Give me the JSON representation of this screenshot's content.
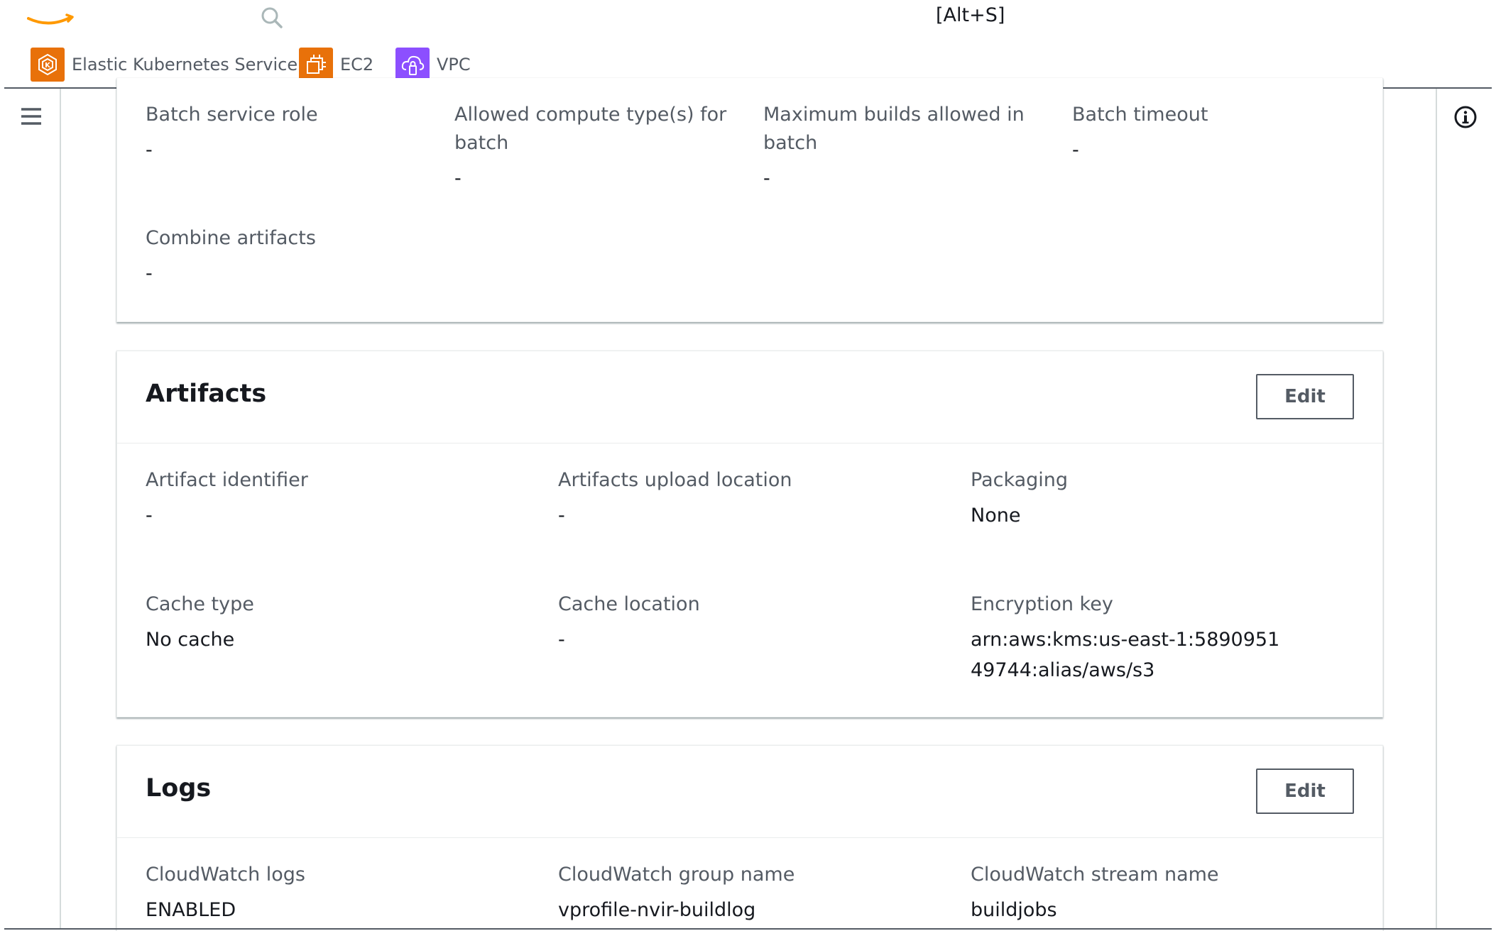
{
  "topbar": {
    "search_shortcut": "[Alt+S]"
  },
  "favorites": [
    {
      "label": "Elastic Kubernetes Service",
      "icon": "eks-icon",
      "color": "#e8710a"
    },
    {
      "label": "EC2",
      "icon": "ec2-icon",
      "color": "#e8710a"
    },
    {
      "label": "VPC",
      "icon": "vpc-icon",
      "color": "#8c4fff"
    }
  ],
  "batch": {
    "fields": [
      {
        "label": "Batch service role",
        "value": "-"
      },
      {
        "label": "Allowed compute type(s) for batch",
        "value": "-"
      },
      {
        "label": "Maximum builds allowed in batch",
        "value": "-"
      },
      {
        "label": "Batch timeout",
        "value": "-"
      },
      {
        "label": "Combine artifacts",
        "value": "-"
      }
    ]
  },
  "artifacts": {
    "title": "Artifacts",
    "edit_label": "Edit",
    "fields": [
      {
        "label": "Artifact identifier",
        "value": "-"
      },
      {
        "label": "Artifacts upload location",
        "value": "-"
      },
      {
        "label": "Packaging",
        "value": "None"
      },
      {
        "label": "Cache type",
        "value": "No cache"
      },
      {
        "label": "Cache location",
        "value": "-"
      },
      {
        "label": "Encryption key",
        "value": "arn:aws:kms:us-east-1:589095149744:alias/aws/s3"
      }
    ]
  },
  "logs": {
    "title": "Logs",
    "edit_label": "Edit",
    "fields": [
      {
        "label": "CloudWatch logs",
        "value": "ENABLED"
      },
      {
        "label": "CloudWatch group name",
        "value": "vprofile-nvir-buildlog"
      },
      {
        "label": "CloudWatch stream name",
        "value": "buildjobs"
      }
    ]
  },
  "colors": {
    "text": "#16191f",
    "label": "#545b64",
    "aws_orange": "#ff9900",
    "border": "#eaeded"
  }
}
